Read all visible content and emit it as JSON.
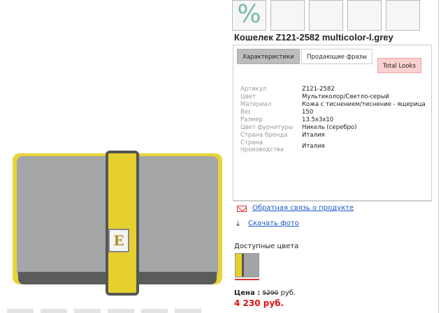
{
  "thumbnails": {
    "percent_symbol": "%",
    "count": 5
  },
  "product": {
    "title": "Кошелек Z121-2582 multicolor-l.grey"
  },
  "tabs": [
    {
      "label": "Характеристики"
    },
    {
      "label": "Продающие фразы"
    },
    {
      "label": "Total Looks"
    }
  ],
  "specs": [
    {
      "key": "Артикул",
      "value": "Z121-2582"
    },
    {
      "key": "Цвет",
      "value": "Мультиколор/Светло-серый"
    },
    {
      "key": "Материал",
      "value": "Кожа с тиснением/тиснение - ящерица"
    },
    {
      "key": "Вес",
      "value": "150"
    },
    {
      "key": "Размер",
      "value": "13.5x3x10"
    },
    {
      "key": "Цвет фурнитуры",
      "value": "Никель (серебро)"
    },
    {
      "key": "Страна бренда",
      "value": "Италия"
    },
    {
      "key": "Страна производства",
      "value": "Италия"
    }
  ],
  "links": {
    "feedback": "Обратная связь о продукте",
    "download_photo": "Скачать фото"
  },
  "colors": {
    "label": "Доступные цвета"
  },
  "price": {
    "label": "Цена :",
    "old": "5290",
    "old_suffix": "руб.",
    "new": "4 230 руб."
  },
  "logo_letter": "E",
  "accent_colors": {
    "price_red": "#dd1111",
    "link_blue": "#1a56c8",
    "tab_active": "#bdbdbd",
    "tab_pink": "#fbd0d0"
  }
}
